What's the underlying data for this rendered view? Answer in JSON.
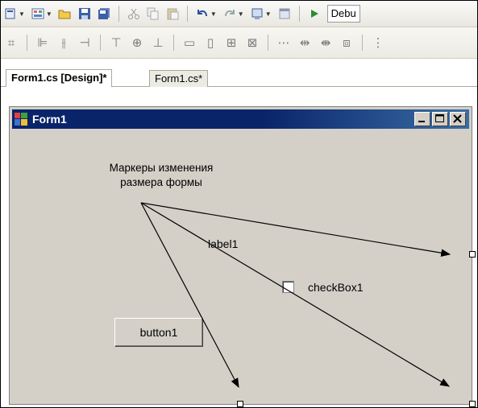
{
  "toolbar": {
    "debug_label": "Debu"
  },
  "tabs": [
    {
      "label": "Form1.cs [Design]*",
      "active": true
    },
    {
      "label": "Form1.cs*",
      "active": false
    }
  ],
  "form": {
    "title": "Form1",
    "annotation_line1": "Маркеры изменения",
    "annotation_line2": "размера формы",
    "label1": "label1",
    "checkbox_label": "checkBox1",
    "checkbox_checked": false,
    "button_label": "button1"
  },
  "caption_buttons": [
    "minimize",
    "maximize",
    "close"
  ],
  "colors": {
    "title_bar": "#0a246a",
    "form_background": "#d4d0c8",
    "debug_play": "#2e8b2e"
  }
}
